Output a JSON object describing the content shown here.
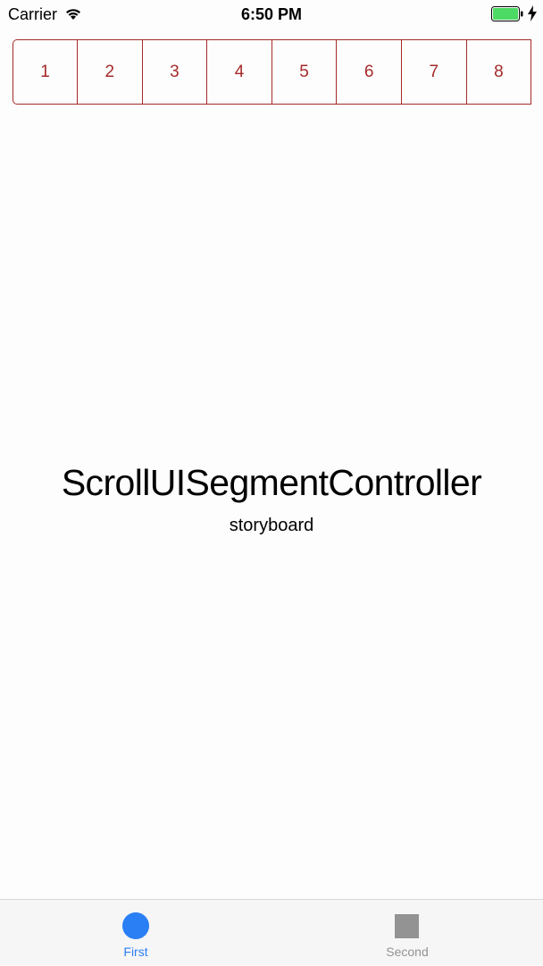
{
  "status_bar": {
    "carrier": "Carrier",
    "time": "6:50 PM",
    "wifi_icon": "wifi-icon",
    "battery_icon": "battery-icon",
    "charging_icon": "charging-bolt-icon",
    "battery_color": "#4cd964"
  },
  "segment_control": {
    "accent_color": "#a52a2a",
    "segments": [
      {
        "label": "1"
      },
      {
        "label": "2"
      },
      {
        "label": "3"
      },
      {
        "label": "4"
      },
      {
        "label": "5"
      },
      {
        "label": "6"
      },
      {
        "label": "7"
      },
      {
        "label": "8"
      }
    ]
  },
  "main": {
    "title": "ScrollUISegmentController",
    "subtitle": "storyboard"
  },
  "tab_bar": {
    "active_color": "#2a7ff4",
    "inactive_color": "#939393",
    "tabs": [
      {
        "label": "First",
        "icon": "circle-icon",
        "selected": true
      },
      {
        "label": "Second",
        "icon": "square-icon",
        "selected": false
      }
    ]
  }
}
